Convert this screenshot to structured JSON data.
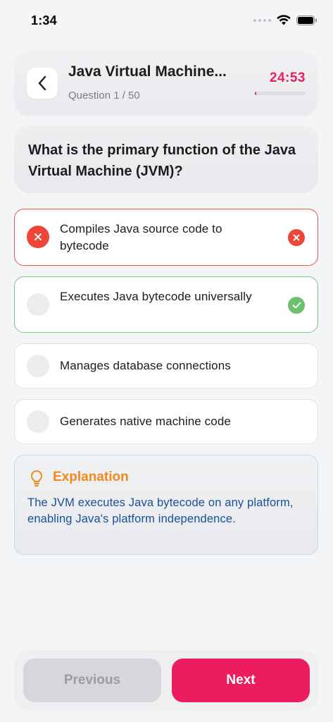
{
  "status_bar": {
    "time": "1:34"
  },
  "header": {
    "title": "Java Virtual Machine...",
    "question_counter": "Question 1 / 50",
    "timer": "24:53",
    "timer_progress": 0.03
  },
  "question": {
    "text": "What is the primary function of the Java Virtual Machine (JVM)?"
  },
  "options": [
    {
      "label": "Compiles Java source code to bytecode",
      "state": "wrong"
    },
    {
      "label": "Executes Java bytecode universally",
      "state": "correct"
    },
    {
      "label": "Manages database connections",
      "state": "default"
    },
    {
      "label": "Generates native machine code",
      "state": "default"
    }
  ],
  "explanation": {
    "title": "Explanation",
    "text": "The JVM executes Java bytecode on any platform, enabling Java's platform independence."
  },
  "navigation": {
    "previous_label": "Previous",
    "next_label": "Next"
  },
  "colors": {
    "accent": "#ec1d5e",
    "wrong": "#ef4539",
    "correct": "#6cc070",
    "explanation_title": "#f08a1c",
    "explanation_text": "#1a4fa0"
  }
}
